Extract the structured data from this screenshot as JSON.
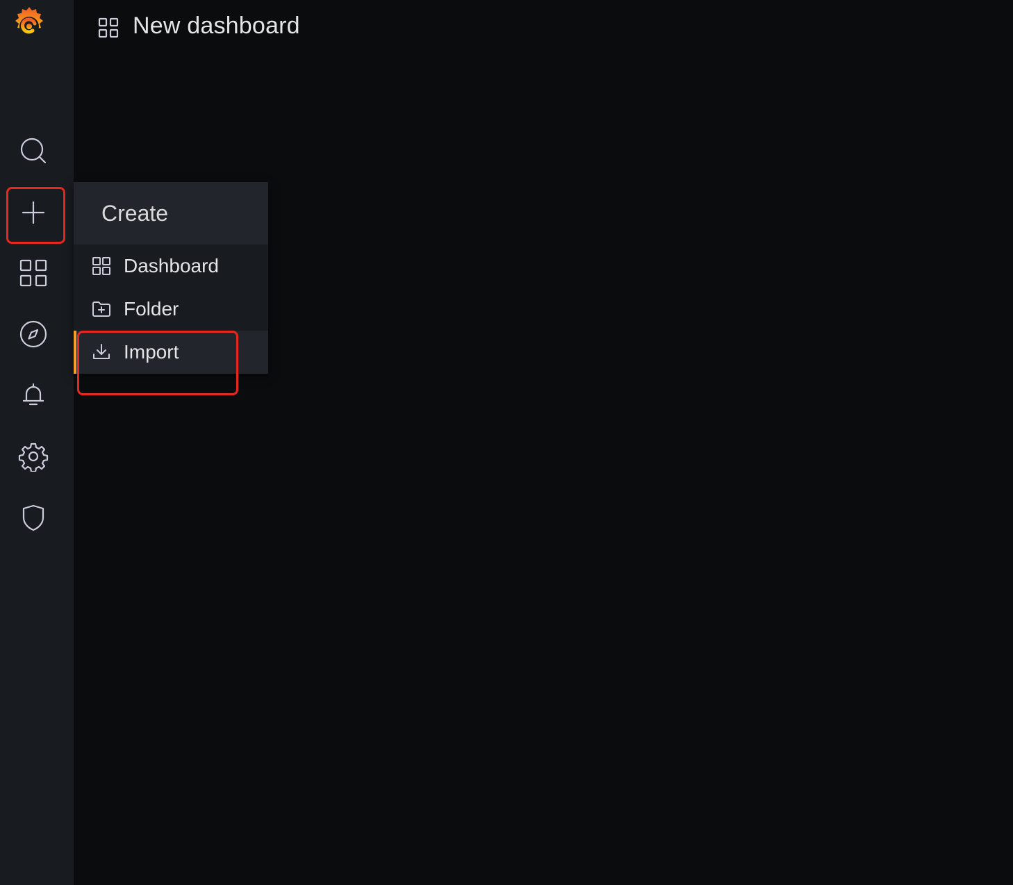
{
  "header": {
    "title": "New dashboard",
    "title_icon": "dashboard-grid-icon"
  },
  "sidebar": {
    "logo": "grafana-logo-icon",
    "items": [
      {
        "id": "search",
        "icon": "search-icon"
      },
      {
        "id": "create",
        "icon": "plus-icon"
      },
      {
        "id": "dashboards",
        "icon": "dashboard-grid-icon"
      },
      {
        "id": "explore",
        "icon": "compass-icon"
      },
      {
        "id": "alerting",
        "icon": "bell-icon"
      },
      {
        "id": "configuration",
        "icon": "gear-icon"
      },
      {
        "id": "server-admin",
        "icon": "shield-icon"
      }
    ]
  },
  "create_menu": {
    "header": "Create",
    "items": [
      {
        "label": "Dashboard",
        "icon": "dashboard-grid-icon"
      },
      {
        "label": "Folder",
        "icon": "folder-plus-icon"
      },
      {
        "label": "Import",
        "icon": "import-icon",
        "active": true
      }
    ]
  },
  "colors": {
    "background": "#0b0c0e",
    "sidebar": "#181b1f",
    "menu_header": "#22252b",
    "active_indicator": "#f89f2b",
    "annotation_highlight": "#e8281e"
  }
}
